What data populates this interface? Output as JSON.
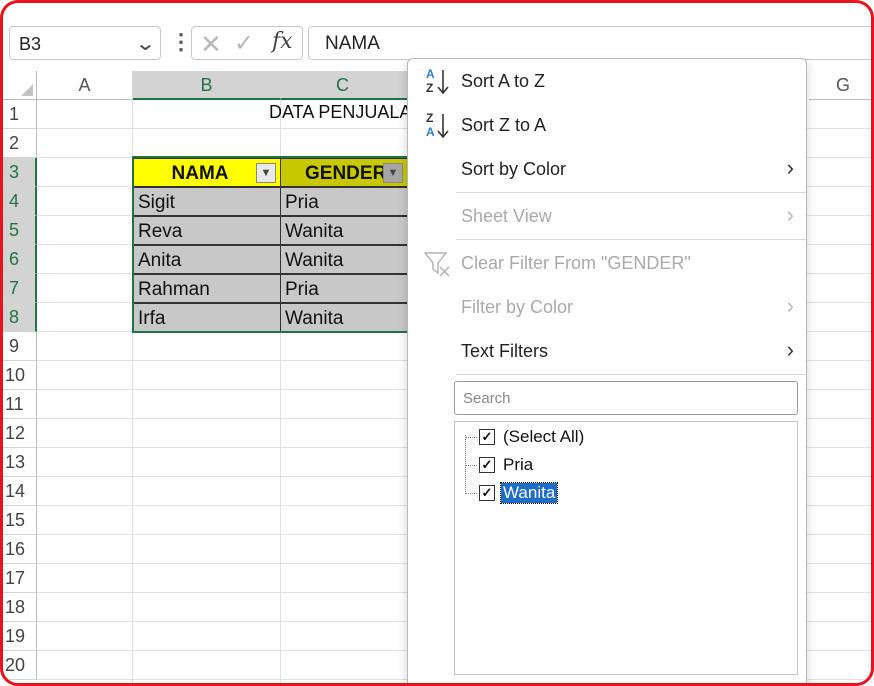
{
  "formula_bar": {
    "name_box": "B3",
    "formula": "NAMA",
    "cancel_icon": "x-icon",
    "enter_icon": "check-icon",
    "fx_label": "fx"
  },
  "grid": {
    "columns": [
      "A",
      "B",
      "C",
      "G"
    ],
    "rows": [
      "1",
      "2",
      "3",
      "4",
      "5",
      "6",
      "7",
      "8",
      "9",
      "10",
      "11",
      "12",
      "13",
      "14",
      "15",
      "16",
      "17",
      "18",
      "19",
      "20"
    ],
    "title": "DATA PENJUALA",
    "headers": [
      "NAMA",
      "GENDER"
    ],
    "records": [
      [
        "Sigit",
        "Pria"
      ],
      [
        "Reva",
        "Wanita"
      ],
      [
        "Anita",
        "Wanita"
      ],
      [
        "Rahman",
        "Pria"
      ],
      [
        "Irfa",
        "Wanita"
      ]
    ],
    "colors": {
      "header_fill": "#ffff00",
      "data_fill": "#c8c8c8",
      "selection": "#217346"
    }
  },
  "filter_menu": {
    "sort_az": "Sort A to Z",
    "sort_za": "Sort Z to A",
    "sort_by_color": "Sort by Color",
    "sheet_view": "Sheet View",
    "clear_filter": "Clear Filter From \"GENDER\"",
    "filter_by_color": "Filter by Color",
    "text_filters": "Text Filters",
    "search_placeholder": "Search",
    "items": [
      {
        "label": "(Select All)",
        "checked": true
      },
      {
        "label": "Pria",
        "checked": true
      },
      {
        "label": "Wanita",
        "checked": true
      }
    ]
  }
}
